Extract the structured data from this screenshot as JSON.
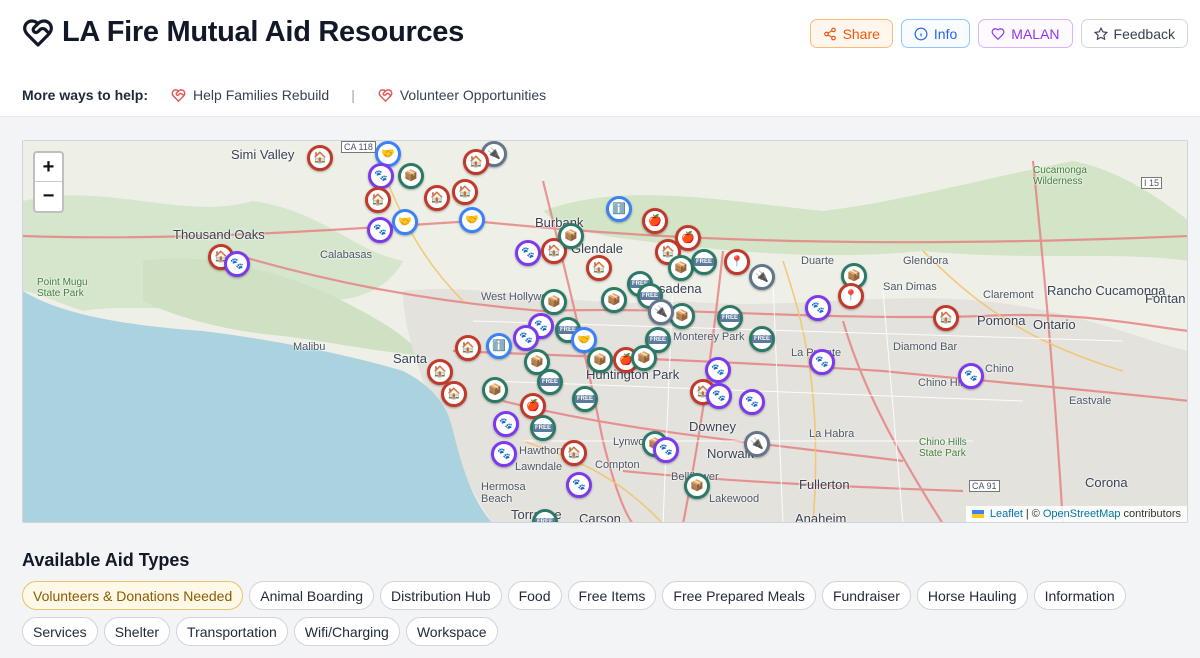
{
  "app": {
    "title": "LA Fire Mutual Aid Resources"
  },
  "actions": {
    "share": "Share",
    "info": "Info",
    "malan": "MALAN",
    "feedback": "Feedback"
  },
  "help": {
    "label": "More ways to help:",
    "links": [
      "Help Families Rebuild",
      "Volunteer Opportunities"
    ],
    "separator": "|"
  },
  "map": {
    "zoom_in": "+",
    "zoom_out": "−",
    "attribution": {
      "leaflet": "Leaflet",
      "sep": "|",
      "copyright": "©",
      "osm": "OpenStreetMap",
      "suffix": "contributors"
    },
    "labels": [
      "Simi Valley",
      "Thousand Oaks",
      "Calabasas",
      "Malibu",
      "Point Mugu State Park",
      "Santa",
      "West Hollywood",
      "Burbank",
      "Glendale",
      "Pasadena",
      "Duarte",
      "Glendora",
      "San Dimas",
      "Claremont",
      "Rancho Cucamonga",
      "Fontan",
      "Ontario",
      "Pomona",
      "Diamond Bar",
      "Chino Hills",
      "Chino",
      "Eastvale",
      "La Puente",
      "Monterey Park",
      "Huntington Park",
      "Downey",
      "Norwalk",
      "La Habra",
      "Fullerton",
      "Lakewood",
      "Bellflower",
      "Compton",
      "Lynwood",
      "Hawthorne",
      "Lawndale",
      "Hermosa Beach",
      "Torrance",
      "Carson",
      "Anaheim",
      "Corona",
      "Cucamonga Wilderness",
      "Chino Hills State Park",
      "CA 118",
      "CA 91",
      "I 15"
    ]
  },
  "aid_types": {
    "title": "Available Aid Types",
    "chips": [
      "Volunteers & Donations Needed",
      "Animal Boarding",
      "Distribution Hub",
      "Food",
      "Free Items",
      "Free Prepared Meals",
      "Fundraiser",
      "Horse Hauling",
      "Information",
      "Services",
      "Shelter",
      "Transportation",
      "Wifi/Charging",
      "Workspace"
    ]
  },
  "colors": {
    "share": "#ea580c",
    "info": "#2563eb",
    "malan": "#9333ea",
    "shelter": "#c0392b",
    "animal": "#7c3aed",
    "distribution": "#2c7a66",
    "information": "#3b82f6",
    "active_chip": "#fef9e7"
  }
}
